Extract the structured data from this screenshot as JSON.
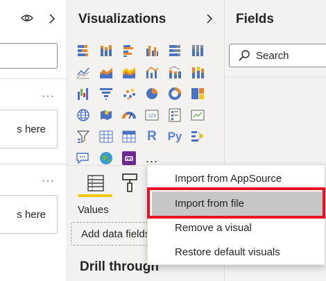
{
  "left_pane": {
    "icons": [
      "eye-icon",
      "chevron-right-icon",
      "more-options-icon"
    ],
    "drop_zone_1": "s here",
    "drop_zone_2": "s here"
  },
  "visualizations": {
    "title": "Visualizations",
    "collapse_icon": "chevron-right-icon",
    "more_label": "...",
    "letter_icons": {
      "r": "R",
      "py": "Py"
    },
    "tabs": [
      "fields-tab-icon",
      "format-tab-icon"
    ],
    "values_label": "Values",
    "add_field_placeholder": "Add data fields",
    "drill_title": "Drill through"
  },
  "fields": {
    "title": "Fields",
    "search_placeholder": "Search"
  },
  "context_menu": {
    "items": [
      "Import from AppSource",
      "Import from file",
      "Remove a visual",
      "Restore default visuals"
    ],
    "highlighted_index": 1,
    "highlight_color": "#e81123"
  },
  "colors": {
    "accent_yellow": "#f2c811",
    "pane_bg": "#f3f2f1",
    "highlight_bg": "#c6c6c6"
  }
}
